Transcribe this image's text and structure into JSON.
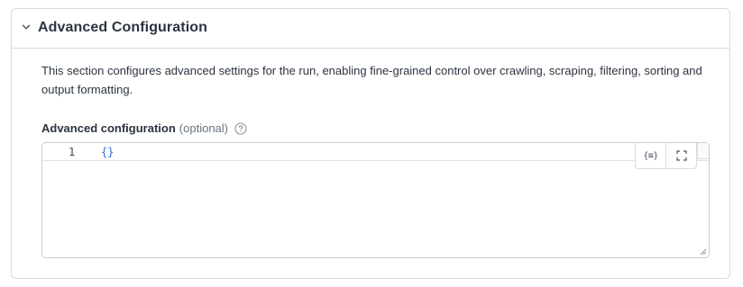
{
  "section": {
    "title": "Advanced Configuration",
    "expanded": true,
    "description": "This section configures advanced settings for the run, enabling fine-grained control over crawling, scraping, filtering, sorting and output formatting."
  },
  "field": {
    "label": "Advanced configuration",
    "optional_text": "(optional)",
    "help_icon": "question-circle-icon"
  },
  "editor": {
    "lines": [
      {
        "number": "1",
        "content": "{}"
      }
    ],
    "toolbar": {
      "format_button_icon": "format-json-icon",
      "format_glyph": "{≡}",
      "fullscreen_button_icon": "fullscreen-icon"
    }
  },
  "colors": {
    "border": "#d7dbe0",
    "code_text": "#2f6fdc",
    "muted_text": "#6b7580"
  }
}
